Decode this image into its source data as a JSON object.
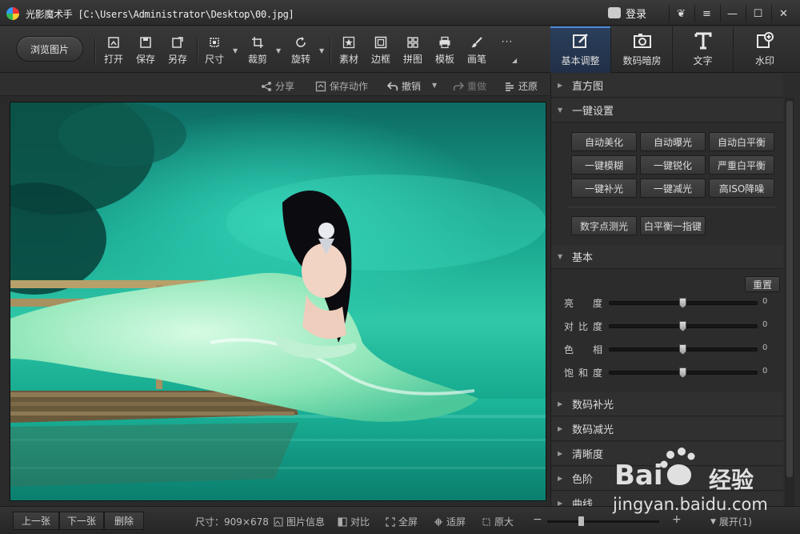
{
  "window": {
    "title": "光影魔术手 [C:\\Users\\Administrator\\Desktop\\00.jpg]",
    "login_label": "登录"
  },
  "toolbar": {
    "browse_label": "浏览图片",
    "tools": [
      {
        "label": "打开",
        "icon": "open-icon"
      },
      {
        "label": "保存",
        "icon": "save-icon"
      },
      {
        "label": "另存",
        "icon": "save-as-icon"
      },
      {
        "label": "尺寸",
        "icon": "resize-icon"
      },
      {
        "label": "裁剪",
        "icon": "crop-icon"
      },
      {
        "label": "旋转",
        "icon": "rotate-icon"
      },
      {
        "label": "素材",
        "icon": "star-icon"
      },
      {
        "label": "边框",
        "icon": "frame-icon"
      },
      {
        "label": "拼图",
        "icon": "grid-icon"
      },
      {
        "label": "模板",
        "icon": "printer-icon"
      },
      {
        "label": "画笔",
        "icon": "brush-icon"
      }
    ],
    "more_label": "···"
  },
  "right_tabs": [
    {
      "label": "基本调整",
      "icon": "edit-icon",
      "active": true
    },
    {
      "label": "数码暗房",
      "icon": "camera-icon",
      "active": false
    },
    {
      "label": "文字",
      "icon": "text-icon",
      "active": false
    },
    {
      "label": "水印",
      "icon": "watermark-icon",
      "active": false
    }
  ],
  "actions": {
    "share": "分享",
    "save_action": "保存动作",
    "undo": "撤销",
    "redo": "重做",
    "restore": "还原"
  },
  "panel": {
    "histogram": "直方图",
    "one_click": "一键设置",
    "one_click_buttons": [
      "自动美化",
      "自动曝光",
      "自动白平衡",
      "一键模糊",
      "一键锐化",
      "严重白平衡",
      "一键补光",
      "一键减光",
      "高ISO降噪"
    ],
    "extra_buttons": [
      "数字点测光",
      "白平衡一指键"
    ],
    "basic": "基本",
    "reset": "重置",
    "sliders": [
      {
        "label": "亮　度",
        "value": 0
      },
      {
        "label": "对比度",
        "value": 0
      },
      {
        "label": "色　相",
        "value": 0
      },
      {
        "label": "饱和度",
        "value": 0
      }
    ],
    "collapsed_sections": [
      "数码补光",
      "数码减光",
      "清晰度",
      "色阶",
      "曲线"
    ]
  },
  "status": {
    "prev": "上一张",
    "next": "下一张",
    "delete": "删除",
    "size": "尺寸：909×678",
    "info": "图片信息",
    "compare": "对比",
    "fullscreen": "全屏",
    "fit": "适屏",
    "original": "原大",
    "zoom_minus": "−",
    "zoom_plus": "+",
    "expand": "展开(1)",
    "zoom_level": 0.3
  },
  "watermark": {
    "brand": "Bai",
    "brand2": "经验",
    "url": "jingyan.baidu.com"
  },
  "colors": {
    "accent": "#4c8ad6",
    "photo_water": "#1fb39a"
  }
}
